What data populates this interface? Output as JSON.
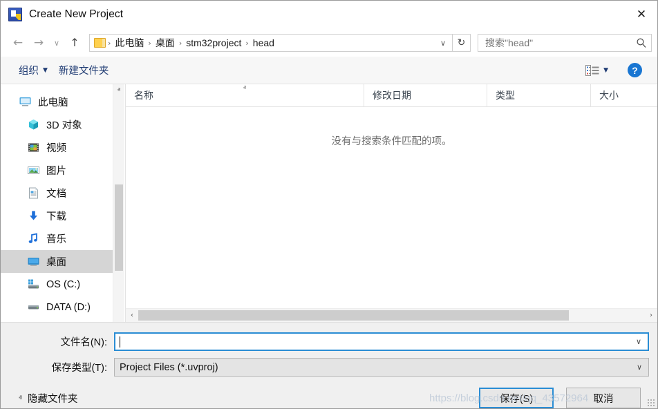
{
  "window": {
    "title": "Create New Project",
    "app_icon": "keil-uvision-icon",
    "close_label": "✕"
  },
  "nav": {
    "back_icon": "←",
    "forward_icon": "→",
    "recent_icon": "∨",
    "up_icon": "↑",
    "refresh_icon": "↻",
    "dropdown_icon": "∨",
    "breadcrumb": [
      {
        "label": "此电脑"
      },
      {
        "label": "桌面"
      },
      {
        "label": "stm32project"
      },
      {
        "label": "head"
      }
    ],
    "separator": "›"
  },
  "search": {
    "placeholder": "搜索\"head\"",
    "value": "",
    "icon": "search-icon"
  },
  "toolbar": {
    "organize_label": "组织",
    "organize_caret": "▼",
    "new_folder_label": "新建文件夹",
    "view_caret": "▼",
    "help_label": "?"
  },
  "sidebar": {
    "items": [
      {
        "label": "此电脑",
        "icon": "computer-icon",
        "level": 0,
        "selected": false
      },
      {
        "label": "3D 对象",
        "icon": "3d-objects-icon",
        "level": 1,
        "selected": false
      },
      {
        "label": "视频",
        "icon": "videos-icon",
        "level": 1,
        "selected": false
      },
      {
        "label": "图片",
        "icon": "pictures-icon",
        "level": 1,
        "selected": false
      },
      {
        "label": "文档",
        "icon": "documents-icon",
        "level": 1,
        "selected": false
      },
      {
        "label": "下载",
        "icon": "downloads-icon",
        "level": 1,
        "selected": false
      },
      {
        "label": "音乐",
        "icon": "music-icon",
        "level": 1,
        "selected": false
      },
      {
        "label": "桌面",
        "icon": "desktop-icon",
        "level": 1,
        "selected": true
      },
      {
        "label": "OS (C:)",
        "icon": "os-drive-icon",
        "level": 1,
        "selected": false
      },
      {
        "label": "DATA (D:)",
        "icon": "data-drive-icon",
        "level": 1,
        "selected": false
      }
    ],
    "scroll_up_icon": "ⱏ",
    "scroll_down_icon": "ⱟ"
  },
  "filelist": {
    "columns": [
      {
        "label": "名称",
        "sorted": true,
        "sort_icon": "ⱏ"
      },
      {
        "label": "修改日期",
        "sorted": false
      },
      {
        "label": "类型",
        "sorted": false
      },
      {
        "label": "大小",
        "sorted": false
      }
    ],
    "empty_message": "没有与搜索条件匹配的项。",
    "rows": [],
    "hscroll_left_icon": "‹",
    "hscroll_right_icon": "›"
  },
  "form": {
    "filename_label": "文件名(N):",
    "filename_value": "",
    "filename_caret": "∨",
    "filetype_label": "保存类型(T):",
    "filetype_value": "Project Files (*.uvproj)",
    "filetype_caret": "∨"
  },
  "actions": {
    "hide_folders_label": "隐藏文件夹",
    "hide_folders_caret": "ⱏ",
    "save_label": "保存(S)",
    "cancel_label": "取消"
  },
  "watermark": {
    "text": "https://blog.csdn.net/qq_43572964"
  },
  "colors": {
    "accent": "#2a8dd4",
    "selection": "#d5d5d5",
    "link": "#1f3b73",
    "help_blue": "#1976d2"
  }
}
